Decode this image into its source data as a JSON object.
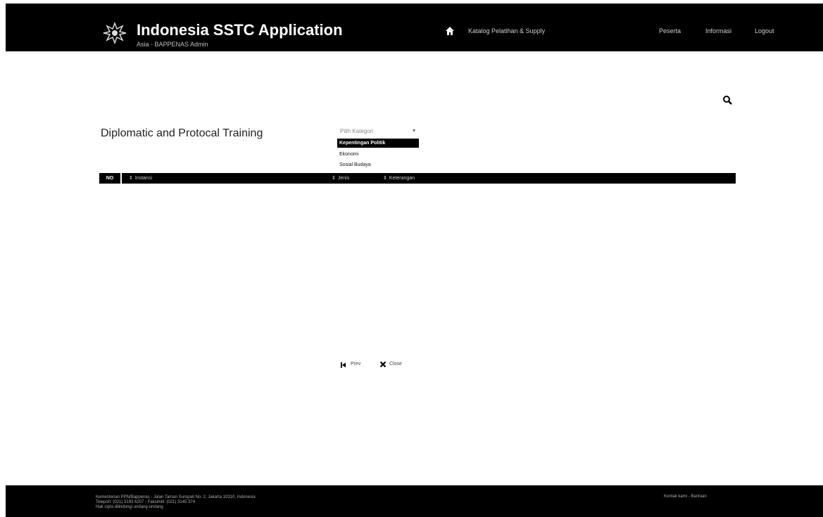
{
  "header": {
    "title": "Indonesia SSTC Application",
    "subtitle": "Asia - BAPPENAS Admin",
    "home_link": "Katalog Pelatihan & Supply",
    "nav_items": [
      "Peserta",
      "Informasi",
      "Logout"
    ],
    "colors": {
      "background": "#000000",
      "title": "#ffffff"
    }
  },
  "page": {
    "title": "Diplomatic and Protocal Training"
  },
  "dropdown": {
    "label": "Pilih Kategori",
    "caret": "▾",
    "options": [
      "Kepentingan Politik",
      "Ekonomi",
      "Sosial Budaya"
    ],
    "selected": "Kepentingan Politik"
  },
  "table": {
    "columns": [
      "NO",
      "Instansi",
      "Jenis",
      "Keterangan"
    ],
    "rows": []
  },
  "pager": {
    "prev_label": "Prev",
    "close_label": "Close"
  },
  "footer": {
    "lines": [
      "Kementerian PPN/Bappenas - Jalan Taman Suropati No. 2, Jakarta 10310, Indonesia",
      "Telepon: (021) 3193 6207 - Faksimili: (021) 3145 374",
      "Hak cipta dilindungi undang-undang"
    ],
    "right": "Kontak kami - Bantuan"
  },
  "icons": {
    "logo": "garuda-logo-icon",
    "home": "home-icon",
    "search": "search-icon",
    "first": "first-page-icon",
    "close": "close-icon"
  }
}
